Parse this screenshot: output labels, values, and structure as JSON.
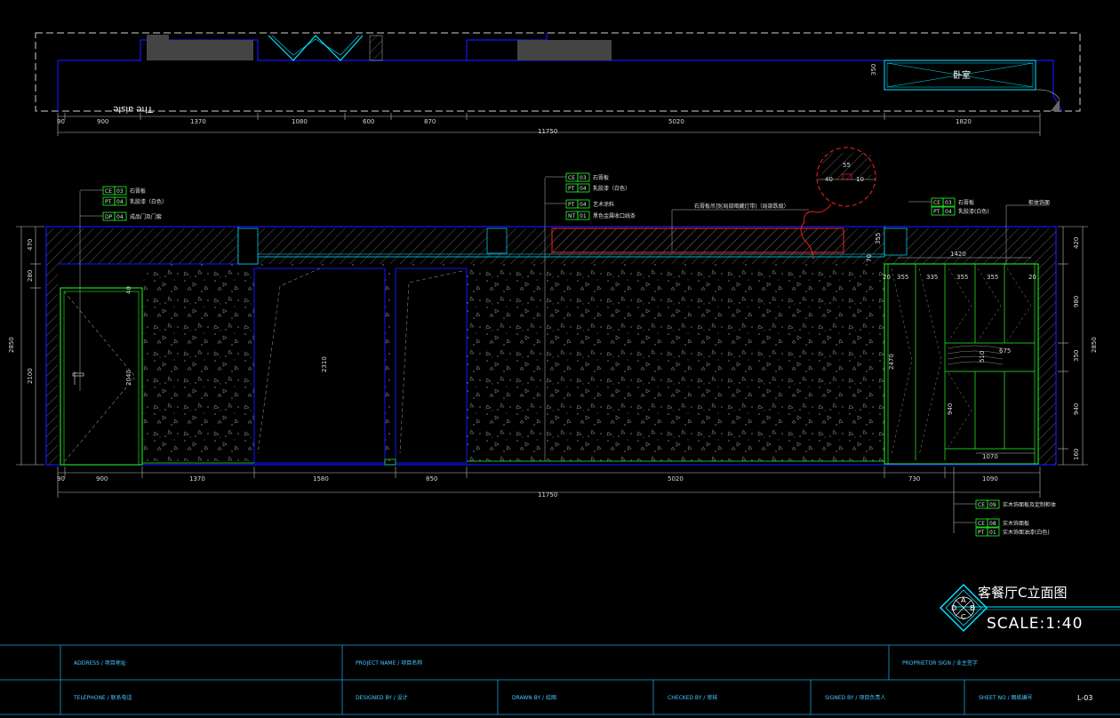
{
  "plan": {
    "aisle_label": "The aisle",
    "room_label": "卧室",
    "side_dim": "350",
    "dims": [
      "90",
      "900",
      "1370",
      "1080",
      "600",
      "870",
      "5020",
      "1820"
    ],
    "total": "11750"
  },
  "elevation": {
    "bottom_dims": [
      "90",
      "900",
      "1370",
      "1580",
      "850",
      "5020",
      "730",
      "1090"
    ],
    "bottom_total": "11750",
    "left_dims": [
      "470",
      "280",
      "2100"
    ],
    "left_total": "2850",
    "right_dims": [
      "420",
      "980",
      "350",
      "940",
      "160"
    ],
    "right_total": "2850",
    "inner": {
      "door_height": "2040",
      "door_gap": "40",
      "opening_height": "2310",
      "cab_height": "2470",
      "cab_lower": "940",
      "cab_mid": "510",
      "cab_top_width": "1420",
      "cab_cols": [
        "20",
        "355",
        "335",
        "355",
        "355",
        "20"
      ],
      "cab_shelf": "675",
      "cab_bottom": "1070",
      "small_70": "70",
      "small_355": "355"
    },
    "detail": {
      "d55": "55",
      "d40": "40",
      "d10": "10"
    }
  },
  "tags": [
    {
      "code": "CE",
      "num": "03",
      "text": "石膏板"
    },
    {
      "code": "PT",
      "num": "04",
      "text": "乳胶漆（白色）"
    },
    {
      "code": "DP",
      "num": "04",
      "text": "成品门及门套"
    },
    {
      "code": "CE",
      "num": "03",
      "text": "石膏板"
    },
    {
      "code": "PT",
      "num": "04",
      "text": "乳胶漆（白色）"
    },
    {
      "code": "PT",
      "num": "04",
      "text": "艺术涂料"
    },
    {
      "code": "NT",
      "num": "01",
      "text": "黑色金属收口线条"
    },
    {
      "code": "CE",
      "num": "03",
      "text": "石膏板"
    },
    {
      "code": "PT",
      "num": "04",
      "text": "乳胶漆(白色)"
    },
    {
      "code": "CE",
      "num": "09",
      "text": "实木饰面板及定制柜体"
    },
    {
      "code": "CE",
      "num": "08",
      "text": "实木饰面板"
    },
    {
      "code": "PT",
      "num": "01",
      "text": "实木饰面油漆(白色)"
    }
  ],
  "notes": {
    "ceiling": "石膏板吊顶(局部暗藏灯带)（局部跌级）",
    "right": "柜体饰面"
  },
  "title": {
    "name": "客餐厅C立面图",
    "scale": "SCALE:1:40",
    "index_letters": [
      "A",
      "B",
      "C",
      "D"
    ]
  },
  "titleblock": {
    "address": "ADDRESS / 项目地址",
    "project": "PROJECT NAME / 项目名称",
    "proprietor": "PROPRIETOR SIGN / 业主签字",
    "telephone": "TELEPHONE / 联系电话",
    "designed": "DESIGNED BY / 设计",
    "drawn": "DRAWN BY / 绘图",
    "checked": "CHECKED BY / 审核",
    "signed": "SIGNED BY / 项目负责人",
    "sheet": "SHEET NO / 图纸编号",
    "sheet_value": "L-03"
  },
  "colors": {
    "bg": "#000000",
    "wall": "#1414ff",
    "cyan": "#00e5ff",
    "green": "#22ff22",
    "red": "#ff2222",
    "dim": "#bfbfbf",
    "hatch": "#555555"
  }
}
